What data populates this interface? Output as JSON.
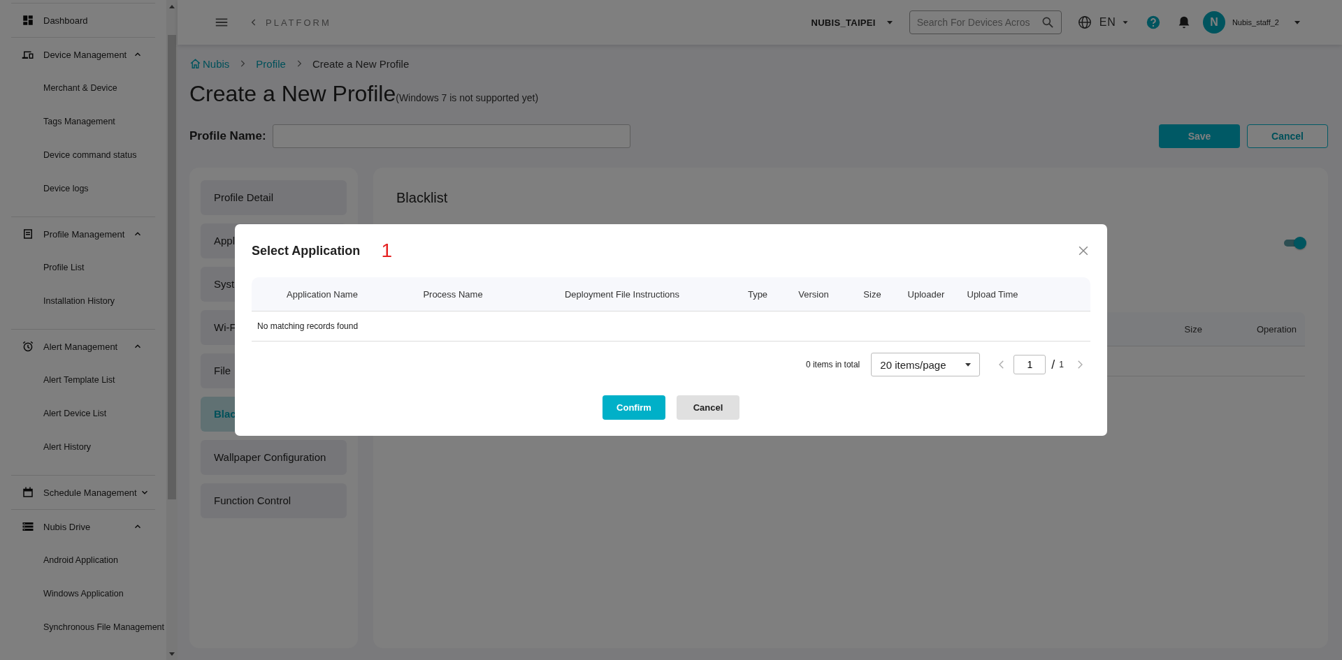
{
  "sidebar": {
    "groups": [
      {
        "label": "Dashboard"
      },
      {
        "label": "Device Management",
        "expanded": true,
        "children": [
          {
            "label": "Merchant & Device"
          },
          {
            "label": "Tags Management"
          },
          {
            "label": "Device command status"
          },
          {
            "label": "Device logs"
          }
        ]
      },
      {
        "label": "Profile Management",
        "expanded": true,
        "children": [
          {
            "label": "Profile List"
          },
          {
            "label": "Installation History"
          }
        ]
      },
      {
        "label": "Alert Management",
        "expanded": true,
        "children": [
          {
            "label": "Alert Template List"
          },
          {
            "label": "Alert Device List"
          },
          {
            "label": "Alert History"
          }
        ]
      },
      {
        "label": "Schedule Management",
        "expanded": false
      },
      {
        "label": "Nubis Drive",
        "expanded": true,
        "children": [
          {
            "label": "Android Application"
          },
          {
            "label": "Windows Application"
          },
          {
            "label": "Synchronous File Management"
          }
        ]
      }
    ]
  },
  "header": {
    "back_label": "PLATFORM",
    "organization": "NUBIS_TAIPEI",
    "search": {
      "placeholder": "Search For Devices Acros"
    },
    "language": "EN",
    "avatar": "N",
    "user": "Nubis_staff_2"
  },
  "breadcrumb": [
    {
      "label": "Nubis",
      "kind": "home"
    },
    {
      "label": "Profile",
      "kind": "link"
    },
    {
      "label": "Create a New Profile",
      "kind": "current"
    }
  ],
  "title": "Create a New Profile",
  "title_note": "(Windows 7 is not supported yet)",
  "profile_name": {
    "label": "Profile Name:"
  },
  "actions": [
    {
      "label": "Save",
      "kind": "primary"
    },
    {
      "label": "Cancel",
      "kind": "outline"
    }
  ],
  "sections": [
    {
      "label": "Profile Detail",
      "selected": false
    },
    {
      "label": "Appl",
      "selected": false
    },
    {
      "label": "Syst",
      "selected": false
    },
    {
      "label": "Wi-F",
      "selected": false
    },
    {
      "label": "File",
      "selected": false
    },
    {
      "label": "Blac",
      "selected": true
    },
    {
      "label": "Wallpaper Configuration",
      "selected": false
    },
    {
      "label": "Function Control",
      "selected": false
    }
  ],
  "panel": {
    "title": "Blacklist",
    "toggle": {
      "on": true
    },
    "visible_columns": [
      "Size",
      "Operation"
    ]
  },
  "modal": {
    "title": "Select Application",
    "marker": "1",
    "columns": [
      "Application Name",
      "Process Name",
      "Deployment File Instructions",
      "Type",
      "Version",
      "Size",
      "Uploader",
      "Upload Time"
    ],
    "empty_text": "No matching records found",
    "total": "0 items in total",
    "page_size": "20 items/page",
    "page": "1",
    "separator": "/",
    "page_count": "1",
    "buttons": [
      {
        "label": "Confirm",
        "kind": "primary"
      },
      {
        "label": "Cancel",
        "kind": "secondary"
      }
    ]
  }
}
